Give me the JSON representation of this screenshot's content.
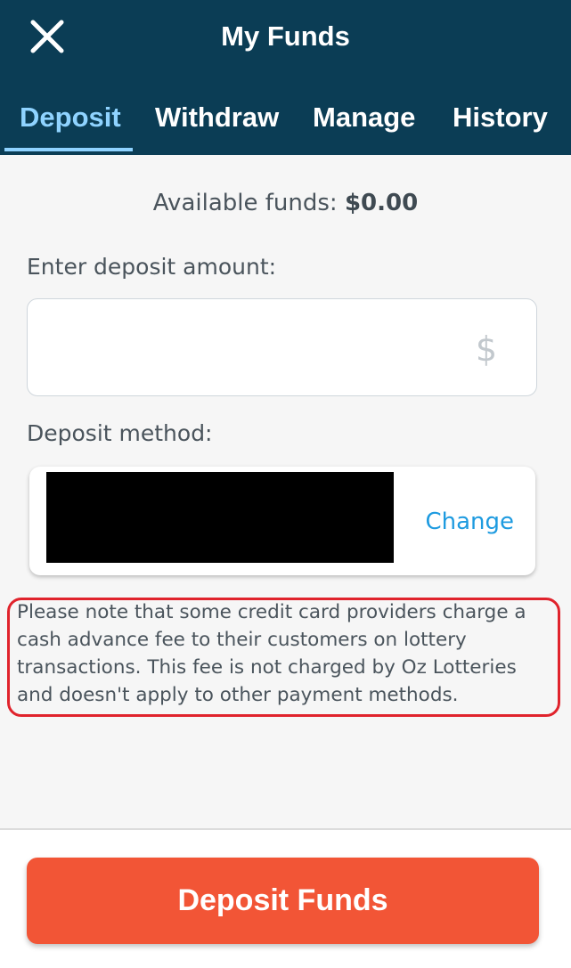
{
  "header": {
    "title": "My Funds",
    "close_icon": "close-icon",
    "background_color": "#0b3d55"
  },
  "tabs": [
    {
      "label": "Deposit",
      "active": true
    },
    {
      "label": "Withdraw",
      "active": false
    },
    {
      "label": "Manage",
      "active": false
    },
    {
      "label": "History",
      "active": false
    }
  ],
  "funds": {
    "label": "Available funds:",
    "amount": "$0.00"
  },
  "deposit_amount": {
    "label": "Enter deposit amount:",
    "value": "",
    "currency_symbol": "$"
  },
  "deposit_method": {
    "label": "Deposit method:",
    "change_label": "Change"
  },
  "notice": {
    "text": "Please note that some credit card providers charge a cash advance fee to their customers on lottery transactions. This fee is not charged by Oz Lotteries and doesn't apply to other payment methods.",
    "highlight_color": "#e0232c"
  },
  "footer": {
    "deposit_button_label": "Deposit Funds",
    "button_color": "#f25536"
  },
  "colors": {
    "accent": "#8fd3ff",
    "link": "#1e9be0"
  }
}
